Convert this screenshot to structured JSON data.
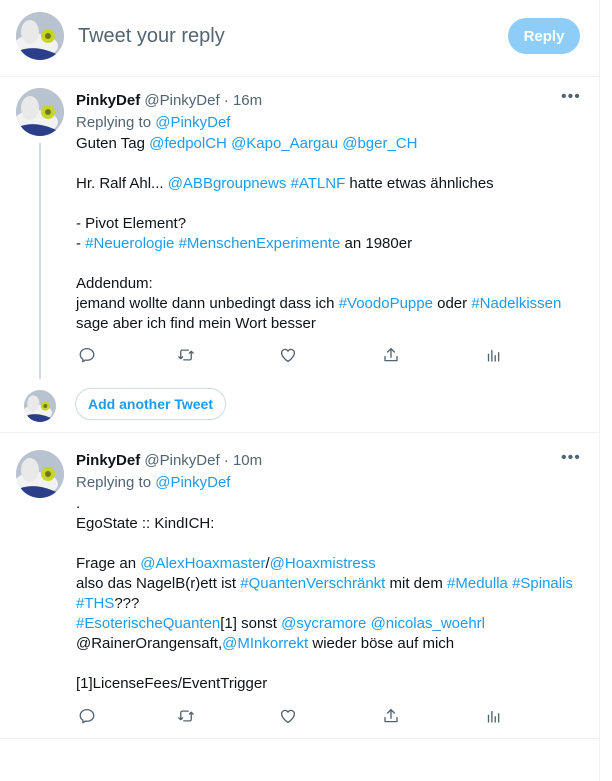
{
  "compose": {
    "placeholder": "Tweet your reply",
    "reply_label": "Reply"
  },
  "tweets": [
    {
      "name": "PinkyDef",
      "handle": "@PinkyDef",
      "time": "16m",
      "replying_prefix": "Replying to",
      "replying_to": "@PinkyDef",
      "lines": [
        [
          {
            "t": "Guten Tag "
          },
          {
            "t": "@fedpolCH",
            "l": 1
          },
          {
            "t": " "
          },
          {
            "t": "@Kapo_Aargau",
            "l": 1
          },
          {
            "t": " "
          },
          {
            "t": "@bger_CH",
            "l": 1
          }
        ],
        [],
        [
          {
            "t": "Hr. Ralf Ahl... "
          },
          {
            "t": "@ABBgroupnews",
            "l": 1
          },
          {
            "t": " "
          },
          {
            "t": "#ATLNF",
            "l": 1
          },
          {
            "t": " hatte etwas ähnliches"
          }
        ],
        [],
        [
          {
            "t": "- Pivot Element?"
          }
        ],
        [
          {
            "t": "- "
          },
          {
            "t": "#Neuerologie",
            "l": 1
          },
          {
            "t": " "
          },
          {
            "t": "#MenschenExperimente",
            "l": 1
          },
          {
            "t": " an 1980er"
          }
        ],
        [],
        [
          {
            "t": "Addendum:"
          }
        ],
        [
          {
            "t": "jemand wollte dann unbedingt dass ich "
          },
          {
            "t": "#VoodoPuppe",
            "l": 1
          },
          {
            "t": " oder "
          },
          {
            "t": "#Nadelkissen",
            "l": 1
          }
        ],
        [
          {
            "t": "sage aber ich find mein Wort besser"
          }
        ]
      ]
    },
    {
      "name": "PinkyDef",
      "handle": "@PinkyDef",
      "time": "10m",
      "replying_prefix": "Replying to",
      "replying_to": "@PinkyDef",
      "lines": [
        [
          {
            "t": "."
          }
        ],
        [
          {
            "t": "EgoState :: KindICH:"
          }
        ],
        [],
        [
          {
            "t": "Frage an "
          },
          {
            "t": "@AlexHoaxmaster",
            "l": 1
          },
          {
            "t": "/"
          },
          {
            "t": "@Hoaxmistress",
            "l": 1
          }
        ],
        [
          {
            "t": "also das NagelB(r)ett ist "
          },
          {
            "t": "#QuantenVerschränkt",
            "l": 1
          },
          {
            "t": " mit dem "
          },
          {
            "t": "#Medulla",
            "l": 1
          },
          {
            "t": " "
          },
          {
            "t": "#Spinalis",
            "l": 1
          }
        ],
        [
          {
            "t": "#THS",
            "l": 1
          },
          {
            "t": "???"
          }
        ],
        [
          {
            "t": "#EsoterischeQuanten",
            "l": 1
          },
          {
            "t": "[1] sonst "
          },
          {
            "t": "@sycramore",
            "l": 1
          },
          {
            "t": " "
          },
          {
            "t": "@nicolas_woehrl",
            "l": 1
          }
        ],
        [
          {
            "t": "@RainerOrangensaft,"
          },
          {
            "t": "@MInkorrekt",
            "l": 1
          },
          {
            "t": " wieder böse auf mich"
          }
        ],
        [],
        [
          {
            "t": "[1]LicenseFees/EventTrigger"
          }
        ]
      ]
    }
  ],
  "add_tweet_label": "Add another Tweet",
  "colors": {
    "link": "#1d9bf0",
    "reply_button": "#8ecdf8",
    "muted": "#536471"
  },
  "icons": [
    "reply-icon",
    "retweet-icon",
    "like-icon",
    "share-icon",
    "analytics-icon",
    "more-icon"
  ]
}
